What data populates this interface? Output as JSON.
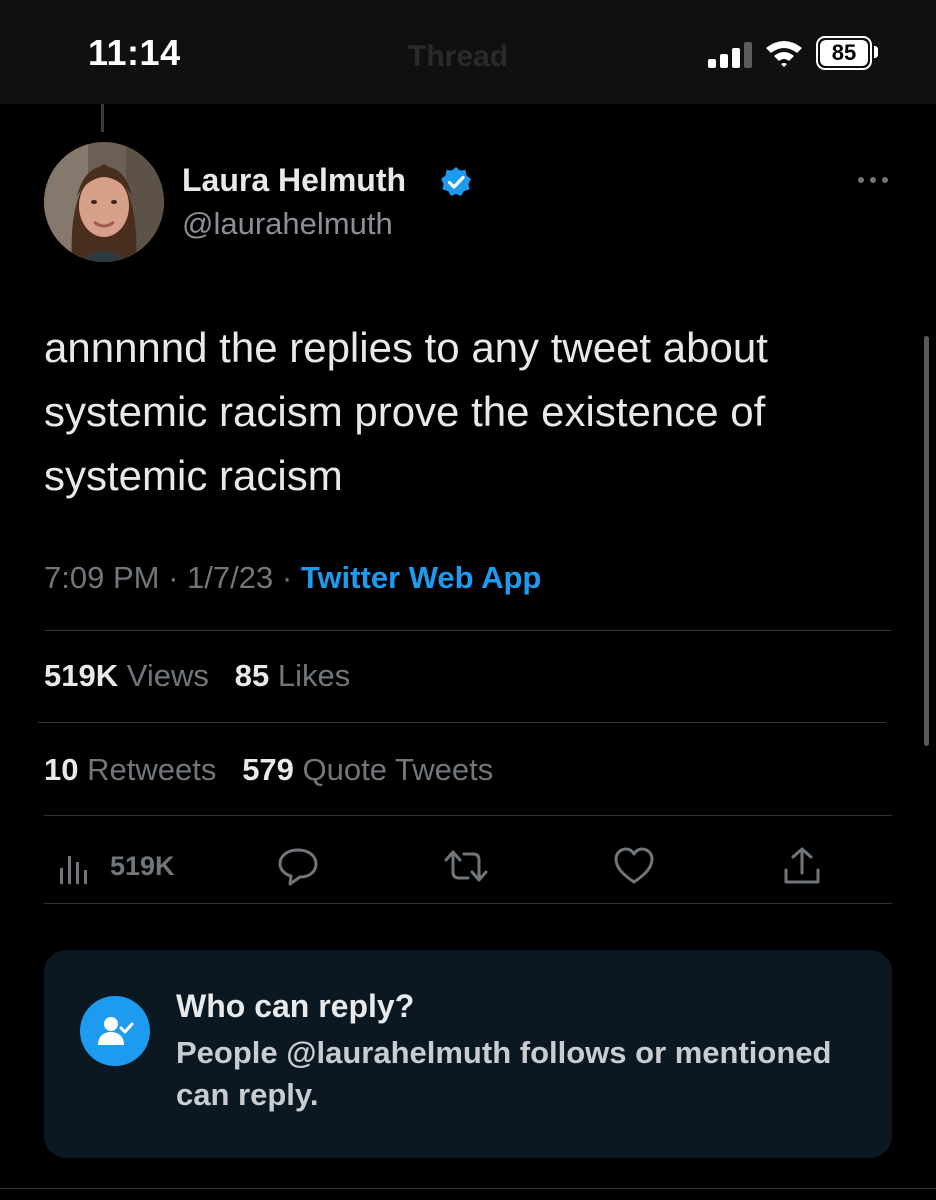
{
  "status_bar": {
    "time": "11:14",
    "battery": "85"
  },
  "nav": {
    "title": "Thread"
  },
  "tweet": {
    "author_name": "Laura Helmuth",
    "author_handle": "@laurahelmuth",
    "verified": true,
    "text": "annnnnd the replies to any tweet about systemic racism prove the existence of systemic racism",
    "time": "7:09 PM",
    "date": "1/7/23",
    "source": "Twitter Web App",
    "sep": "·"
  },
  "stats": {
    "views_count": "519K",
    "views_label": "Views",
    "likes_count": "85",
    "likes_label": "Likes",
    "retweets_count": "10",
    "retweets_label": "Retweets",
    "quotes_count": "579",
    "quotes_label": "Quote Tweets"
  },
  "actions": {
    "views_count": "519K"
  },
  "reply_restriction": {
    "title": "Who can reply?",
    "body": "People @laurahelmuth follows or mentioned can reply."
  },
  "colors": {
    "background": "#000000",
    "accent": "#1d9bf0",
    "muted_text": "#71767b",
    "primary_text": "#e7e9ea",
    "card_background": "#0b1822"
  },
  "icons": {
    "signal": "signal-icon",
    "wifi": "wifi-icon",
    "verified": "verified-badge-icon",
    "more": "more-options-icon",
    "analytics": "analytics-icon",
    "reply": "reply-icon",
    "retweet": "retweet-icon",
    "like": "heart-icon",
    "share": "share-icon",
    "reply_restriction": "user-check-icon"
  }
}
